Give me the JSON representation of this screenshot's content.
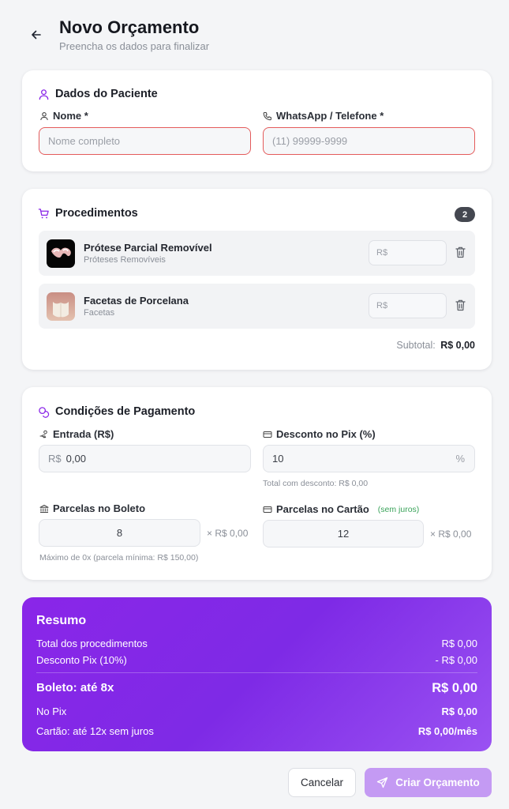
{
  "header": {
    "title": "Novo Orçamento",
    "subtitle": "Preencha os dados para finalizar",
    "back_icon": "arrow-left-icon"
  },
  "patient": {
    "title": "Dados do Paciente",
    "name_label": "Nome *",
    "name_placeholder": "Nome completo",
    "phone_label": "WhatsApp / Telefone *",
    "phone_placeholder": "(11) 99999-9999"
  },
  "procedures": {
    "title": "Procedimentos",
    "count": "2",
    "items": [
      {
        "name": "Prótese Parcial Removível",
        "category": "Próteses Removíveis",
        "price_placeholder": "R$"
      },
      {
        "name": "Facetas de Porcelana",
        "category": "Facetas",
        "price_placeholder": "R$"
      }
    ],
    "subtotal_label": "Subtotal:",
    "subtotal_value": "R$ 0,00"
  },
  "payment": {
    "title": "Condições de Pagamento",
    "entrada_label": "Entrada (R$)",
    "entrada_prefix": "R$",
    "entrada_value": "0,00",
    "pix_label": "Desconto no Pix (%)",
    "pix_value": "10",
    "pix_suffix": "%",
    "pix_hint": "Total com desconto: R$ 0,00",
    "boleto_label": "Parcelas no Boleto",
    "boleto_value": "8",
    "boleto_each": "× R$ 0,00",
    "boleto_hint": "Máximo de 0x (parcela mínima: R$ 150,00)",
    "cartao_label": "Parcelas no Cartão",
    "cartao_tag": "(sem juros)",
    "cartao_value": "12",
    "cartao_each": "× R$ 0,00"
  },
  "summary": {
    "title": "Resumo",
    "total_label": "Total dos procedimentos",
    "total_value": "R$ 0,00",
    "discount_label": "Desconto Pix (10%)",
    "discount_value": "- R$ 0,00",
    "boleto_label": "Boleto: até 8x",
    "boleto_value": "R$ 0,00",
    "pix_label": "No Pix",
    "pix_value": "R$ 0,00",
    "cartao_label": "Cartão: até 12x sem juros",
    "cartao_value": "R$ 0,00/mês"
  },
  "actions": {
    "cancel_label": "Cancelar",
    "create_label": "Criar Orçamento"
  },
  "colors": {
    "accent": "#8a26e8",
    "error_border": "#e45b5b",
    "success_text": "#3aa35a"
  }
}
